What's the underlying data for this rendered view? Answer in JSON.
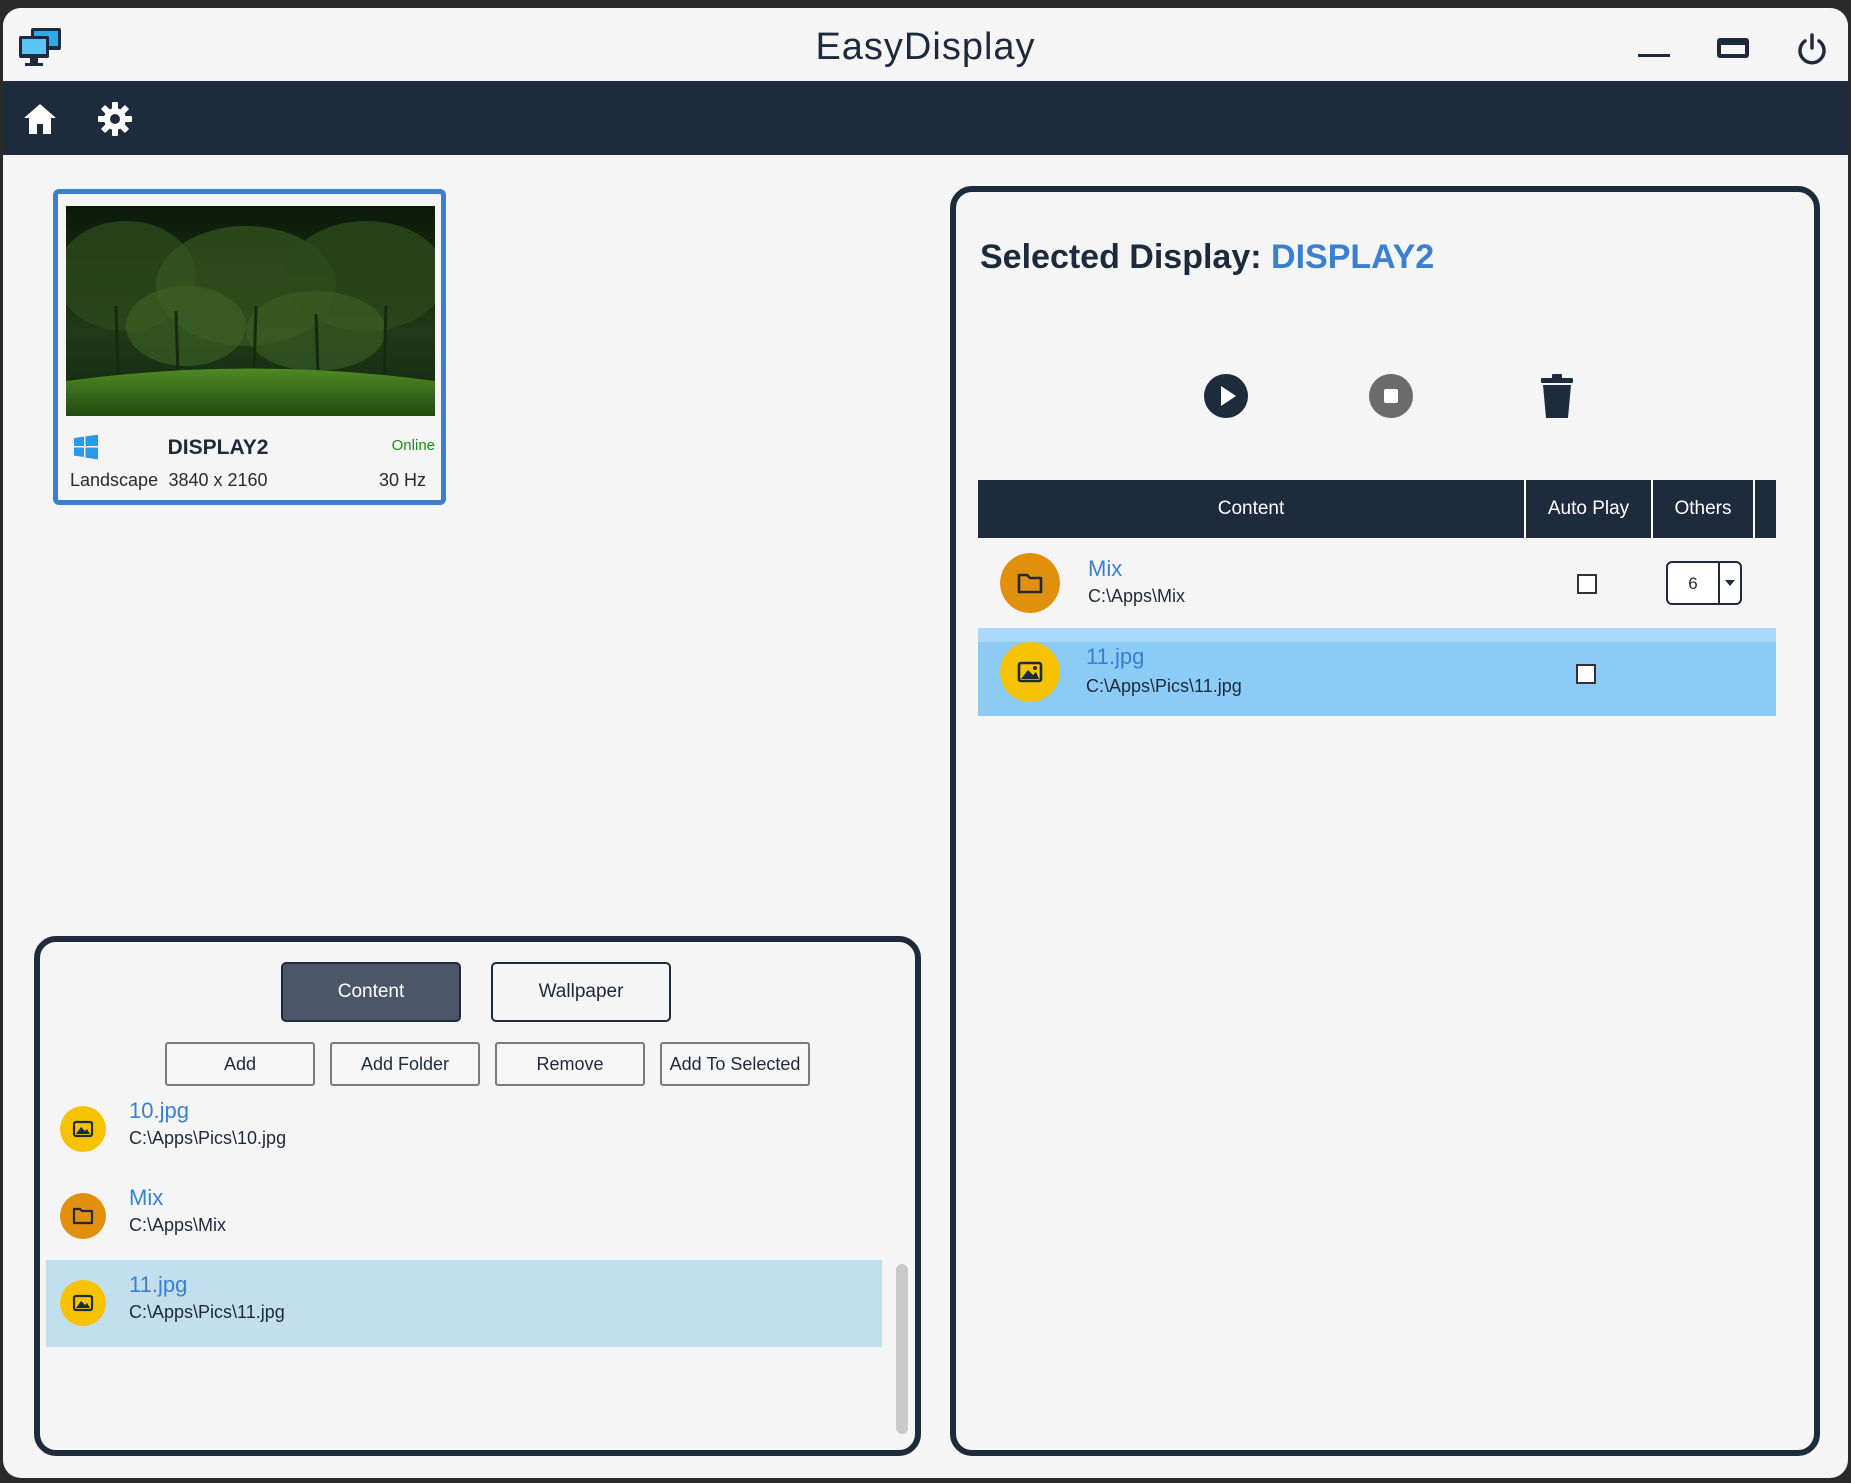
{
  "window": {
    "title": "EasyDisplay",
    "controls": [
      "minimize-icon",
      "maximize-icon",
      "power-icon"
    ]
  },
  "nav": {
    "items": [
      "home-icon",
      "settings-icon"
    ]
  },
  "display_card": {
    "name": "DISPLAY2",
    "status": "Online",
    "orientation": "Landscape",
    "resolution": "3840 x 2160",
    "refresh": "30 Hz"
  },
  "selected": {
    "label": "Selected Display:",
    "display": "DISPLAY2",
    "actions": [
      "play-icon",
      "stop-icon",
      "trash-icon"
    ],
    "table": {
      "headers": {
        "content": "Content",
        "auto_play": "Auto Play",
        "others": "Others"
      },
      "rows": [
        {
          "name": "Mix",
          "path": "C:\\Apps\\Mix",
          "type": "folder",
          "auto_play": false,
          "others": "6"
        },
        {
          "name": "11.jpg",
          "path": "C:\\Apps\\Pics\\11.jpg",
          "type": "image",
          "auto_play": false,
          "selected": true
        }
      ]
    }
  },
  "library": {
    "tabs": {
      "content": "Content",
      "wallpaper": "Wallpaper"
    },
    "buttons": {
      "add": "Add",
      "add_folder": "Add Folder",
      "remove": "Remove",
      "add_to_selected": "Add To Selected"
    },
    "items": [
      {
        "name": "10.jpg",
        "path": "C:\\Apps\\Pics\\10.jpg",
        "type": "image"
      },
      {
        "name": "Mix",
        "path": "C:\\Apps\\Mix",
        "type": "folder"
      },
      {
        "name": "11.jpg",
        "path": "C:\\Apps\\Pics\\11.jpg",
        "type": "image",
        "selected": true
      }
    ]
  },
  "colors": {
    "navy": "#1e2b3c",
    "accent": "#3a7fd0",
    "online": "#1a8a1a",
    "folder": "#e0900c",
    "image": "#f7c300",
    "row_selected": "#8ccbf6"
  }
}
